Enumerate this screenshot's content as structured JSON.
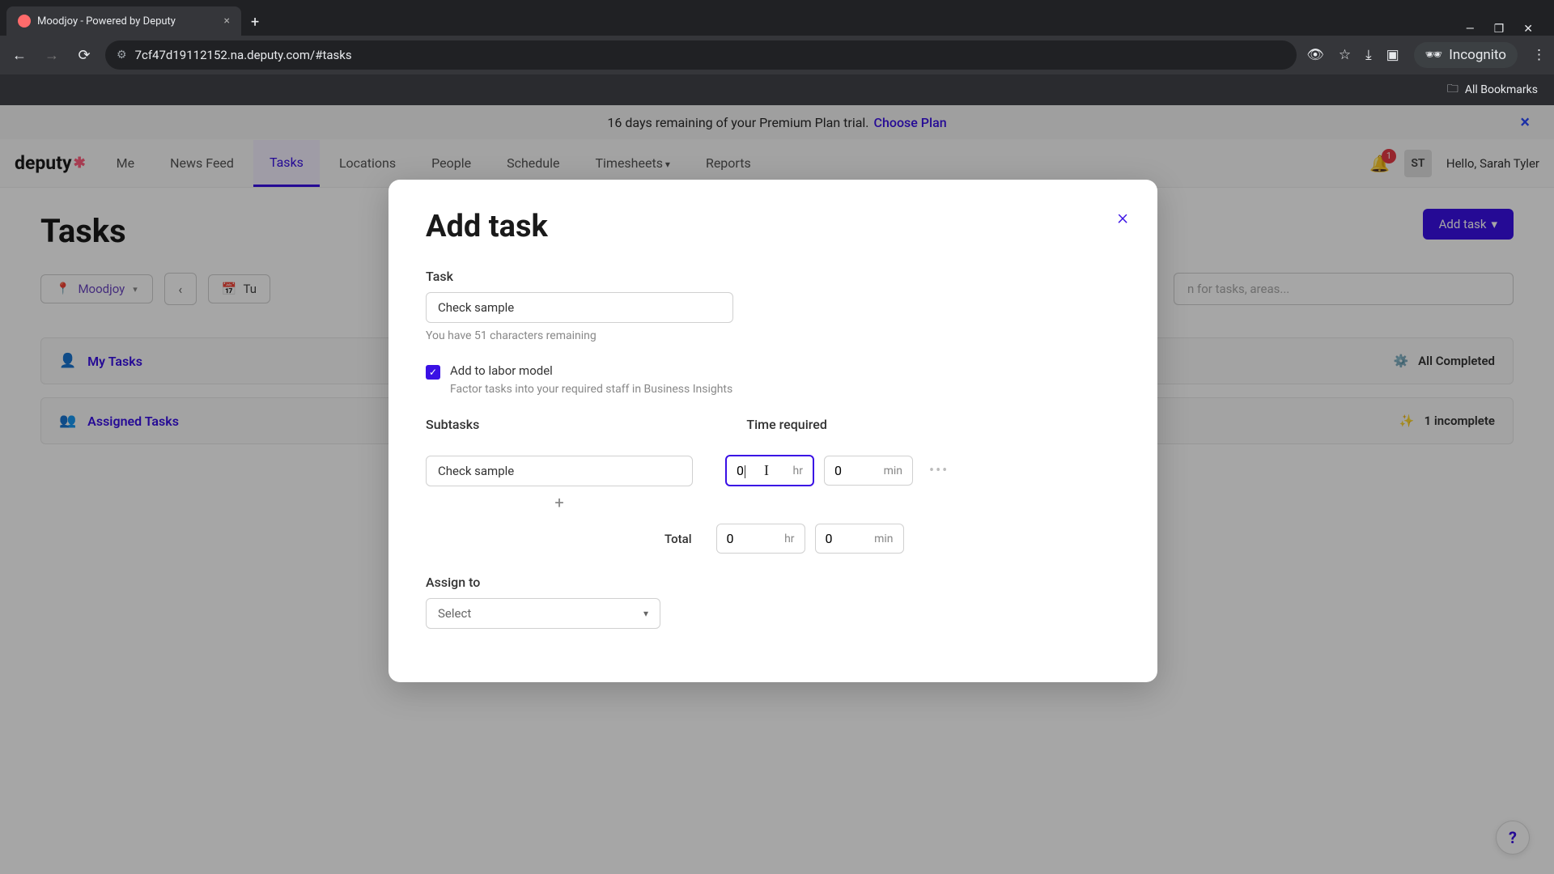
{
  "browser": {
    "tab_title": "Moodjoy - Powered by Deputy",
    "url": "7cf47d19112152.na.deputy.com/#tasks",
    "incognito_label": "Incognito",
    "all_bookmarks": "All Bookmarks"
  },
  "banner": {
    "text": "16 days remaining of your Premium Plan trial.",
    "link": "Choose Plan"
  },
  "nav": {
    "logo": "deputy",
    "items": [
      "Me",
      "News Feed",
      "Tasks",
      "Locations",
      "People",
      "Schedule",
      "Timesheets",
      "Reports"
    ],
    "active_index": 2,
    "dropdown_indices": [
      6
    ],
    "notifications": "1",
    "avatar_initials": "ST",
    "greeting": "Hello, Sarah Tyler"
  },
  "page": {
    "title": "Tasks",
    "location": "Moodjoy",
    "date_partial": "Tu",
    "search_placeholder": "n for tasks, areas...",
    "add_task_btn": "Add task",
    "sections": [
      {
        "icon": "user",
        "label": "My Tasks",
        "status": "All Completed"
      },
      {
        "icon": "users",
        "label": "Assigned Tasks",
        "status": "1 incomplete"
      }
    ]
  },
  "modal": {
    "title": "Add task",
    "task_label": "Task",
    "task_value": "Check sample",
    "chars_hint": "You have 51 characters remaining",
    "labor_checkbox_label": "Add to labor model",
    "labor_checkbox_hint": "Factor tasks into your required staff in Business Insights",
    "labor_checked": true,
    "subtasks_label": "Subtasks",
    "time_label": "Time required",
    "subtask_value": "Check sample",
    "hr_value": "0",
    "hr_unit": "hr",
    "min_value": "0",
    "min_unit": "min",
    "total_label": "Total",
    "total_hr": "0",
    "total_min": "0",
    "assign_label": "Assign to",
    "assign_placeholder": "Select"
  }
}
